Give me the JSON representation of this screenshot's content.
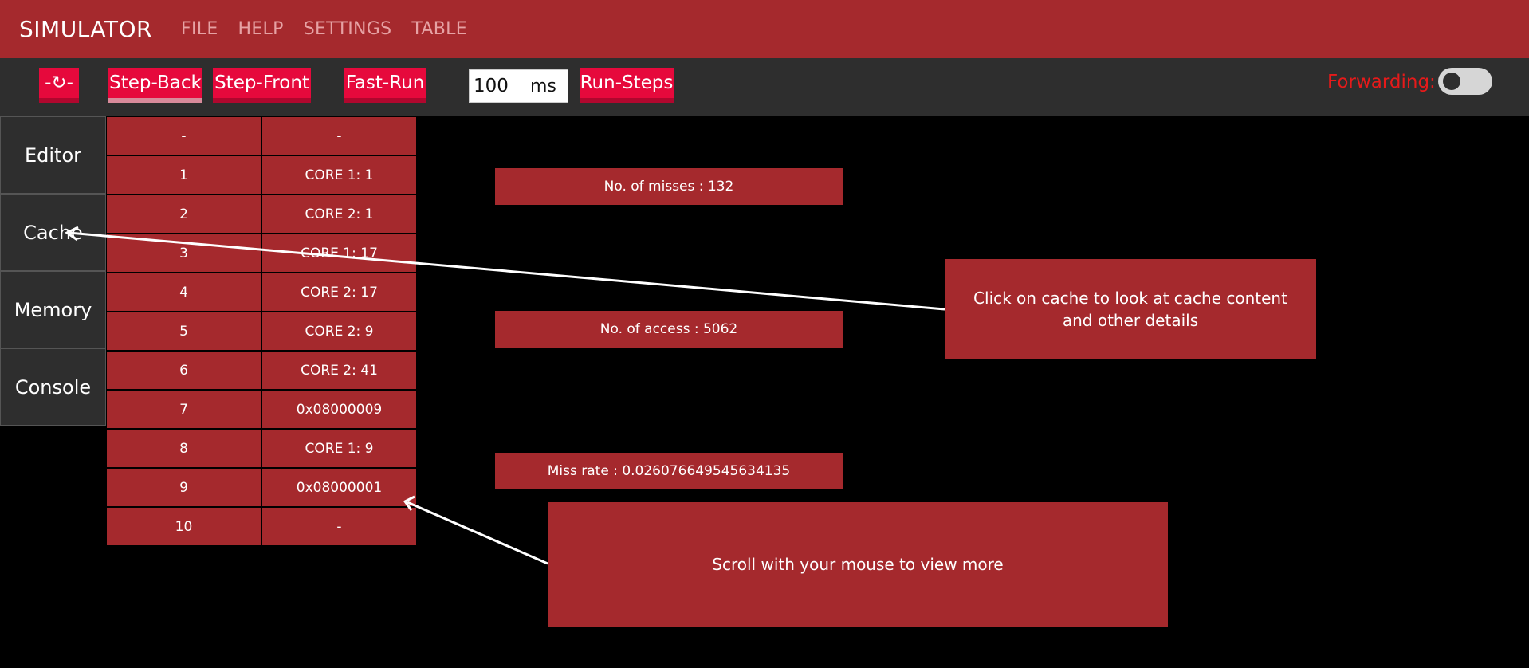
{
  "app": {
    "brand": "SIMULATOR",
    "menu": [
      "FILE",
      "HELP",
      "SETTINGS",
      "TABLE"
    ]
  },
  "toolbar": {
    "reset_label": "-↻-",
    "step_back_label": "Step-Back",
    "step_front_label": "Step-Front",
    "fast_run_label": "Fast-Run",
    "delay_value": "100",
    "delay_unit": "ms",
    "run_steps_label": "Run-Steps",
    "forwarding_label": "Forwarding:",
    "forwarding_on": false
  },
  "sidebar": {
    "items": [
      "Editor",
      "Cache",
      "Memory",
      "Console"
    ]
  },
  "cache_table": {
    "rows": [
      [
        "-",
        "-"
      ],
      [
        "1",
        "CORE 1: 1"
      ],
      [
        "2",
        "CORE 2: 1"
      ],
      [
        "3",
        "CORE 1: 17"
      ],
      [
        "4",
        "CORE 2: 17"
      ],
      [
        "5",
        "CORE 2: 9"
      ],
      [
        "6",
        "CORE 2: 41"
      ],
      [
        "7",
        "0x08000009"
      ],
      [
        "8",
        "CORE 1: 9"
      ],
      [
        "9",
        "0x08000001"
      ],
      [
        "10",
        "-"
      ]
    ]
  },
  "stats": {
    "misses": "No. of misses : 132",
    "access": "No. of access : 5062",
    "miss_rate": "Miss rate : 0.026076649545634135"
  },
  "tooltips": {
    "cache_hint": "Click on cache to look at cache content and other details",
    "scroll_hint": "Scroll with your mouse to view more"
  },
  "colors": {
    "brand_red": "#a5292d",
    "button_red": "#e6093c",
    "toolbar_bg": "#2e2e2e",
    "forwarding_label": "#e61a1a"
  }
}
